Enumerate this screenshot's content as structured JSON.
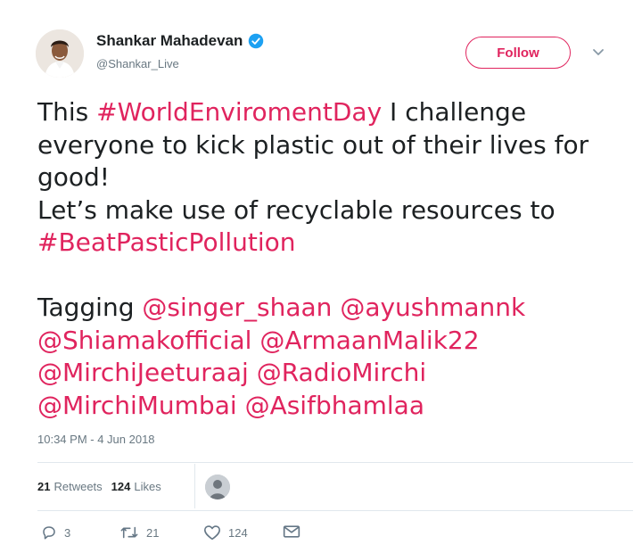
{
  "user": {
    "name": "Shankar Mahadevan",
    "handle": "@Shankar_Live",
    "verified": true
  },
  "follow_label": "Follow",
  "tweet": {
    "lines": [
      [
        {
          "t": "This ",
          "c": "text"
        },
        {
          "t": "#WorldEnviromentDay",
          "c": "hashtag"
        },
        {
          "t": " I challenge",
          "c": "text"
        }
      ],
      [
        {
          "t": "everyone to kick plastic out of their lives for",
          "c": "text"
        }
      ],
      [
        {
          "t": "good!",
          "c": "text"
        }
      ],
      [
        {
          "t": "Let’s make use of recyclable resources to",
          "c": "text"
        }
      ],
      [
        {
          "t": "#BeatPasticPollution",
          "c": "hashtag"
        }
      ],
      [],
      [
        {
          "t": "Tagging ",
          "c": "text"
        },
        {
          "t": "@singer_shaan",
          "c": "mention"
        },
        {
          "t": " ",
          "c": "text"
        },
        {
          "t": "@ayushmannk",
          "c": "mention"
        }
      ],
      [
        {
          "t": "@Shiamakofficial",
          "c": "mention"
        },
        {
          "t": " ",
          "c": "text"
        },
        {
          "t": "@ArmaanMalik22",
          "c": "mention"
        }
      ],
      [
        {
          "t": "@MirchiJeeturaaj",
          "c": "mention"
        },
        {
          "t": " ",
          "c": "text"
        },
        {
          "t": "@RadioMirchi",
          "c": "mention"
        }
      ],
      [
        {
          "t": "@MirchiMumbai",
          "c": "mention"
        },
        {
          "t": " ",
          "c": "text"
        },
        {
          "t": "@Asifbhamlaa",
          "c": "mention"
        }
      ]
    ]
  },
  "timestamp": "10:34 PM - 4 Jun 2018",
  "stats": {
    "retweets_count": "21",
    "retweets_label": "Retweets",
    "likes_count": "124",
    "likes_label": "Likes"
  },
  "actions": {
    "reply_count": "3",
    "retweet_count": "21",
    "like_count": "124"
  },
  "colors": {
    "accent": "#e0245e",
    "text": "#1c2022",
    "muted": "#697882",
    "verified": "#1da1f2"
  },
  "icons": [
    "verified-badge-icon",
    "chevron-down-icon",
    "reply-icon",
    "retweet-icon",
    "heart-icon",
    "direct-message-icon"
  ]
}
